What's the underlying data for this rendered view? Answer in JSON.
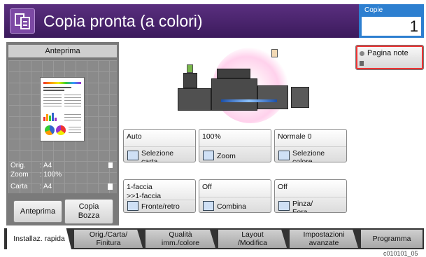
{
  "header": {
    "title": "Copia pronta (a colori)",
    "copies_label": "Copie",
    "copies_value": "1"
  },
  "preview": {
    "title": "Anteprima",
    "info": [
      {
        "label": "Orig.",
        "value": ": A4"
      },
      {
        "label": "Zoom",
        "value": ": 100%"
      },
      {
        "label": "Carta",
        "value": ": A4"
      }
    ],
    "preview_button": "Anteprima",
    "draft_button": "Copia\nBozza"
  },
  "pad_note_button": "Pagina note",
  "functions": [
    {
      "value": "Auto",
      "name": "Selezione\ncarta",
      "icon": "paper-tray-icon"
    },
    {
      "value": "100%",
      "name": "Zoom",
      "icon": "zoom-icon"
    },
    {
      "value": "Normale 0",
      "name": "Selezione\ncolore",
      "icon": "color-select-icon"
    },
    {
      "value": "1-faccia\n>>1-faccia",
      "name": "Fronte/retro",
      "icon": "duplex-icon"
    },
    {
      "value": "Off",
      "name": "Combina",
      "icon": "combine-icon"
    },
    {
      "value": "Off",
      "name": "Pinza/\nFora",
      "icon": "staple-icon"
    }
  ],
  "tabs": [
    {
      "label": "Installaz. rapida"
    },
    {
      "label": "Orig./Carta/\nFinitura"
    },
    {
      "label": "Qualità\nimm./colore"
    },
    {
      "label": "Layout\n/Modifica"
    },
    {
      "label": "Impostazioni\navanzate"
    },
    {
      "label": "Programma"
    }
  ],
  "footer_code": "c010101_05"
}
